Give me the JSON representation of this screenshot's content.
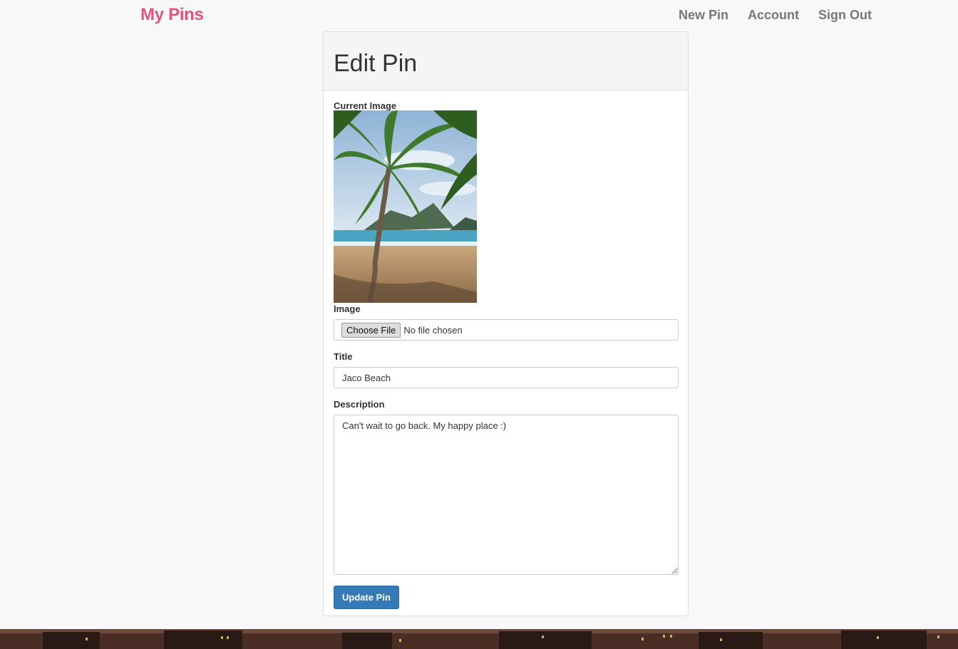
{
  "navbar": {
    "brand": "My Pins",
    "links": [
      "New Pin",
      "Account",
      "Sign Out"
    ]
  },
  "panel": {
    "title": "Edit Pin"
  },
  "form": {
    "current_image_label": "Current Image",
    "image_label": "Image",
    "choose_file_label": "Choose File",
    "no_file_text": "No file chosen",
    "title_label": "Title",
    "title_value": "Jaco Beach",
    "description_label": "Description",
    "description_value": "Can't wait to go back. My happy place :)",
    "submit_label": "Update Pin"
  },
  "colors": {
    "brand": "#e0557a",
    "primary_button": "#337ab7",
    "background": "#f8f8f8"
  }
}
